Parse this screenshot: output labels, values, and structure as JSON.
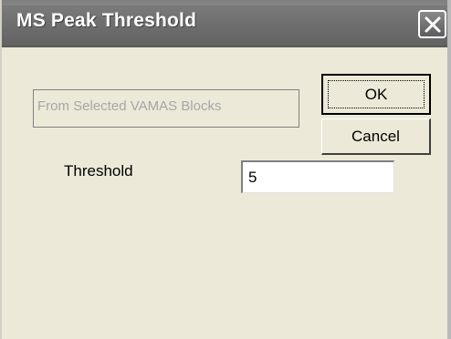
{
  "window": {
    "title": "MS Peak Threshold",
    "close_icon": "close-icon"
  },
  "dialog": {
    "source_group_label": "From Selected VAMAS Blocks",
    "ok_label": "OK",
    "cancel_label": "Cancel",
    "threshold_label": "Threshold",
    "threshold_value": "5"
  },
  "colors": {
    "dialog_background": "#ece9d8",
    "titlebar": "#6f6f6f",
    "disabled_text": "#a6a6a6"
  }
}
